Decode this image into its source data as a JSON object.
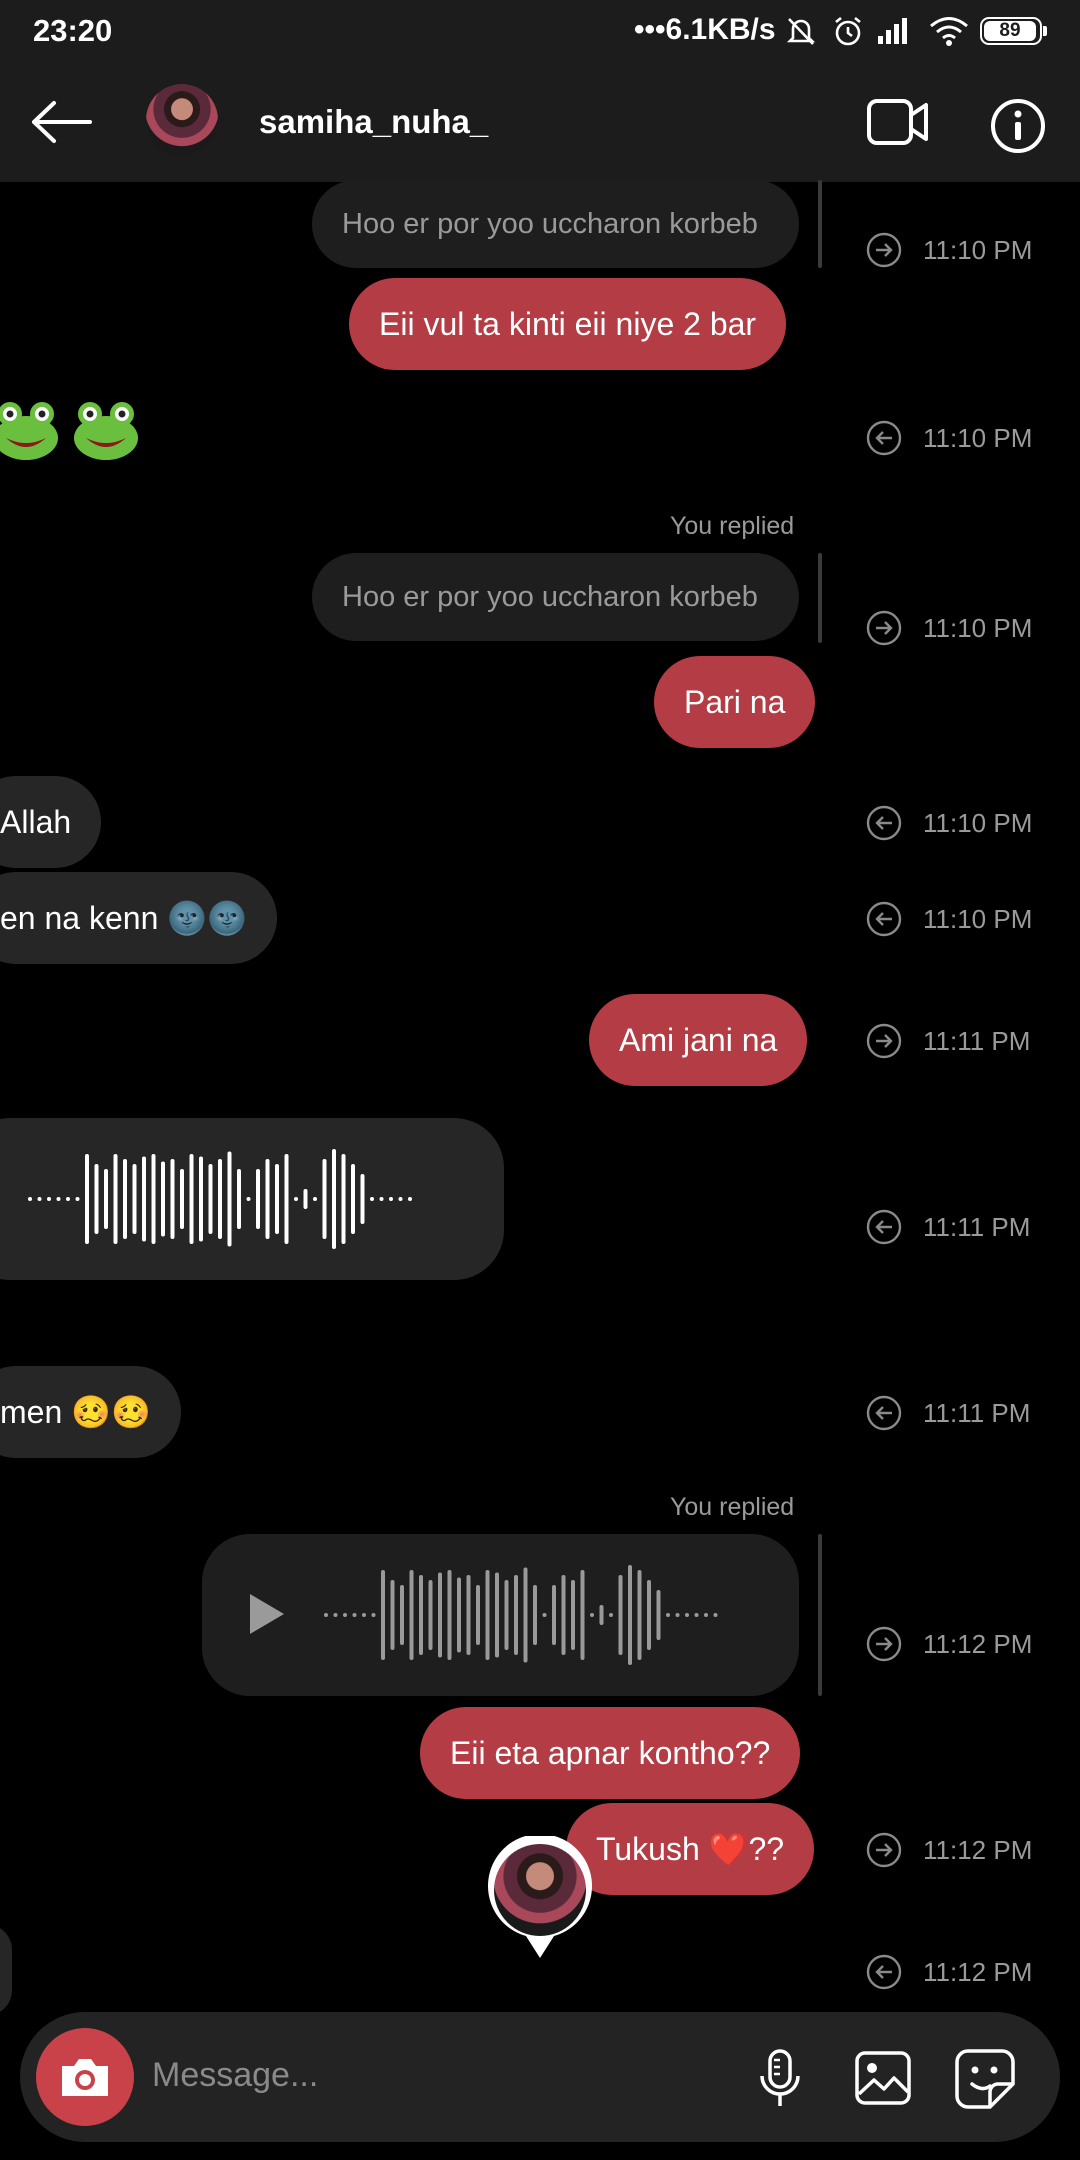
{
  "status_bar": {
    "time": "23:20",
    "network_speed": "•••6.1KB/s",
    "battery": "89"
  },
  "header": {
    "username": "samiha_nuha_"
  },
  "messages": {
    "m1_quote": "Hoo er por yoo uccharon korbeb",
    "m1_time": "11:10 PM",
    "m2_text": "Eii vul ta kinti eii niye 2 bar",
    "m3_time": "11:10 PM",
    "m4_replied": "You replied",
    "m4_quote": "Hoo er por yoo uccharon korbeb",
    "m4_time": "11:10 PM",
    "m5_text": "Pari na",
    "m6_text": "Allah",
    "m6_time": "11:10 PM",
    "m7_text": "en na kenn 🌚🌚",
    "m7_time": "11:10 PM",
    "m8_text": "Ami jani na",
    "m8_time": "11:11 PM",
    "m9_time": "11:11 PM",
    "m10_text": "men 🥴🥴",
    "m10_time": "11:11 PM",
    "m11_replied": "You replied",
    "m11_time": "11:12 PM",
    "m12_text": "Eii eta apnar kontho??",
    "m13_text": "Tukush ❤️??",
    "m13_time": "11:12 PM",
    "m14_time": "11:12 PM"
  },
  "composer": {
    "placeholder": "Message..."
  },
  "colors": {
    "sent_bubble": "#b43c44",
    "received_bubble": "#262626",
    "camera_button": "#c9424a"
  }
}
